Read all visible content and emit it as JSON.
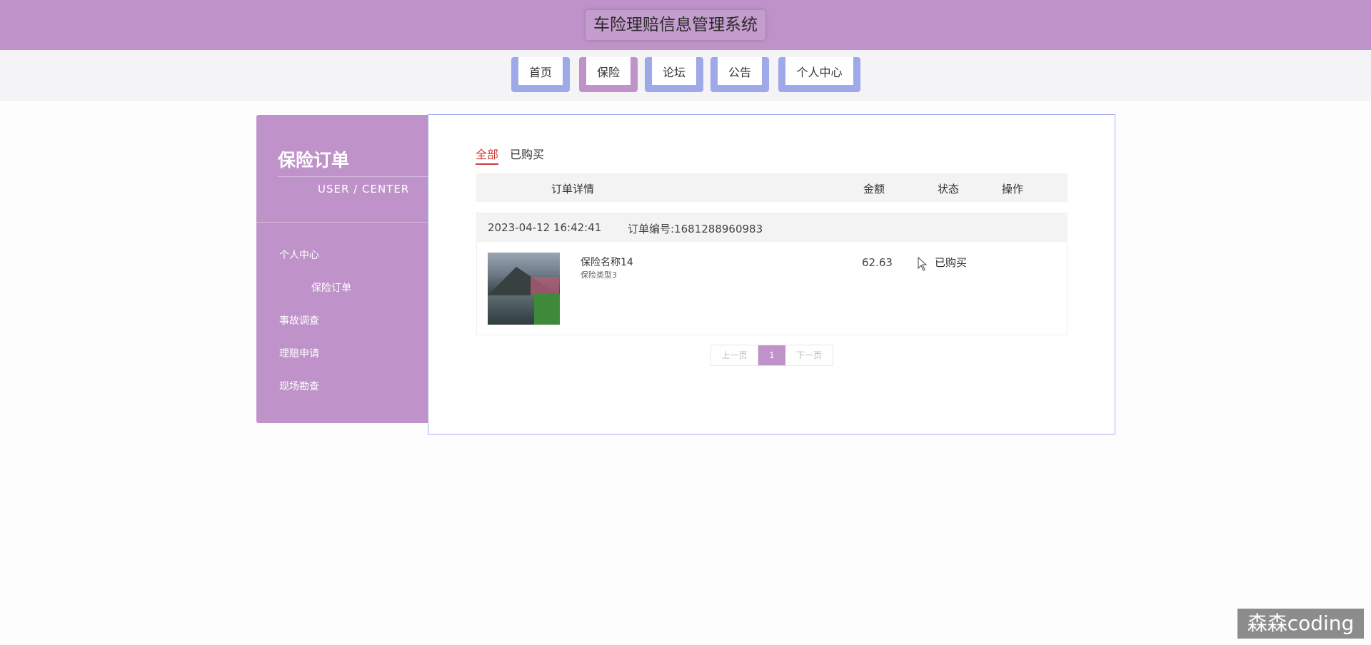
{
  "header": {
    "title": "车险理赔信息管理系统"
  },
  "nav": {
    "items": [
      {
        "label": "首页"
      },
      {
        "label": "保险"
      },
      {
        "label": "论坛"
      },
      {
        "label": "公告"
      },
      {
        "label": "个人中心"
      }
    ],
    "active": "保险"
  },
  "sidebar": {
    "title": "保险订单",
    "subtitle": "USER / CENTER",
    "menu": [
      {
        "label": "个人中心"
      },
      {
        "label": "保险订单"
      },
      {
        "label": "事故调查"
      },
      {
        "label": "理赔申请"
      },
      {
        "label": "现场勘查"
      }
    ]
  },
  "tabs": [
    {
      "label": "全部"
    },
    {
      "label": "已购买"
    }
  ],
  "table": {
    "headers": {
      "detail": "订单详情",
      "amount": "金额",
      "status": "状态",
      "action": "操作"
    }
  },
  "order": {
    "time": "2023-04-12 16:42:41",
    "order_no": "订单编号:1681288960983",
    "product_name": "保险名称14",
    "product_type": "保险类型3",
    "amount": "62.63",
    "status": "已购买"
  },
  "pager": {
    "prev": "上一页",
    "page": "1",
    "next": "下一页"
  },
  "watermark": "森森coding",
  "colors": {
    "primary": "#bf93c9",
    "nav_accent": "#9fa8e8",
    "active_tab": "#d23b3b"
  }
}
